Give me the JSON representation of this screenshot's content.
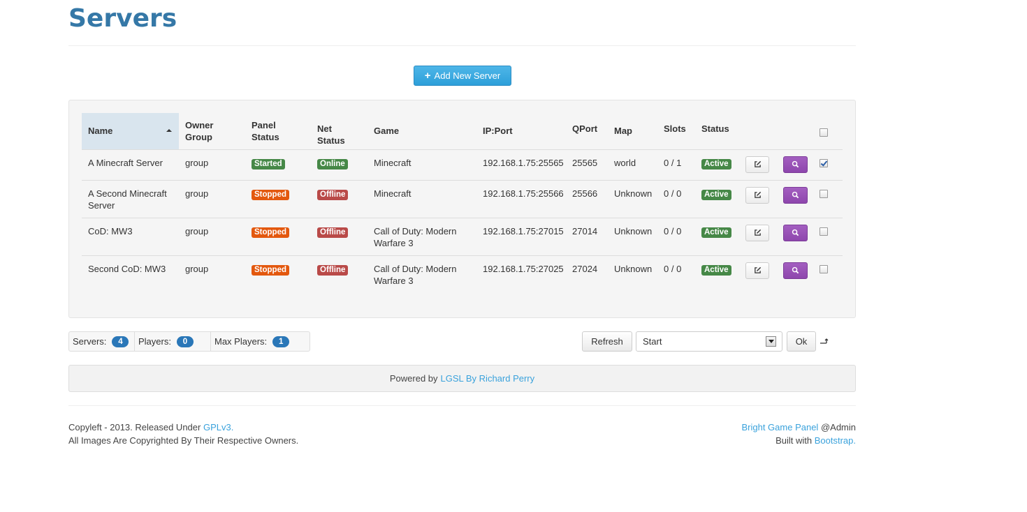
{
  "page": {
    "title": "Servers"
  },
  "toolbar": {
    "add_label": "Add New Server"
  },
  "table": {
    "headers": {
      "name": "Name",
      "owner_group": "Owner Group",
      "panel_status": "Panel Status",
      "net_status": "Net Status",
      "game": "Game",
      "ip_port": "IP:Port",
      "qport": "QPort",
      "map": "Map",
      "slots": "Slots",
      "status": "Status"
    },
    "rows": [
      {
        "name": "A Minecraft Server",
        "owner_group": "group",
        "panel_status": "Started",
        "net_status": "Online",
        "game": "Minecraft",
        "ip_port": "192.168.1.75:25565",
        "qport": "25565",
        "map": "world",
        "slots": "0 / 1",
        "status": "Active",
        "checked": true
      },
      {
        "name": "A Second Minecraft Server",
        "owner_group": "group",
        "panel_status": "Stopped",
        "net_status": "Offline",
        "game": "Minecraft",
        "ip_port": "192.168.1.75:25566",
        "qport": "25566",
        "map": "Unknown",
        "slots": "0 / 0",
        "status": "Active",
        "checked": false
      },
      {
        "name": "CoD: MW3",
        "owner_group": "group",
        "panel_status": "Stopped",
        "net_status": "Offline",
        "game": "Call of Duty: Modern Warfare 3",
        "ip_port": "192.168.1.75:27015",
        "qport": "27014",
        "map": "Unknown",
        "slots": "0 / 0",
        "status": "Active",
        "checked": false
      },
      {
        "name": "Second CoD: MW3",
        "owner_group": "group",
        "panel_status": "Stopped",
        "net_status": "Offline",
        "game": "Call of Duty: Modern Warfare 3",
        "ip_port": "192.168.1.75:27025",
        "qport": "27024",
        "map": "Unknown",
        "slots": "0 / 0",
        "status": "Active",
        "checked": false
      }
    ]
  },
  "stats": {
    "servers_label": "Servers:",
    "servers_value": "4",
    "players_label": "Players:",
    "players_value": "0",
    "max_players_label": "Max Players:",
    "max_players_value": "1"
  },
  "actions": {
    "refresh_label": "Refresh",
    "action_selected": "Start",
    "ok_label": "Ok"
  },
  "powered": {
    "prefix": "Powered by",
    "link": "LGSL By Richard Perry"
  },
  "footer": {
    "left_line1_prefix": "Copyleft - 2013. Released Under",
    "left_line1_link": "GPLv3.",
    "left_line2": "All Images Are Copyrighted By Their Respective Owners.",
    "right_line1_link": "Bright Game Panel",
    "right_line1_suffix": "@Admin",
    "right_line2_prefix": "Built with",
    "right_line2_link": "Bootstrap."
  },
  "colors": {
    "title": "#3578a7",
    "primary_button": "#2d9fd9",
    "label_green": "#468847",
    "label_orange": "#e3580e",
    "label_red": "#b94a48",
    "view_button": "#8e46ad",
    "badge": "#2a77b8",
    "link": "#3aa2dc"
  },
  "icons": {
    "add": "plus-icon",
    "edit": "edit-icon",
    "view": "search-icon",
    "sort": "sort-asc-icon",
    "dropdown": "chevron-down-icon",
    "apply": "apply-arrow-icon"
  }
}
